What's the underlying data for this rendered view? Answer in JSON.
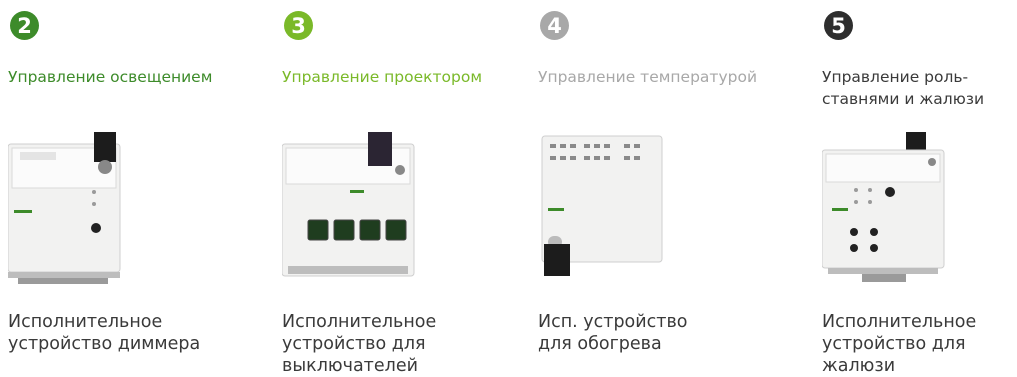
{
  "columns": [
    {
      "number": "2",
      "badge_color": "#3d8b2a",
      "title_color": "#3d8b2a",
      "title": "Управление освещением",
      "device_icon": "dimmer-actuator-icon",
      "caption": "Исполнительное\nустройство диммера"
    },
    {
      "number": "3",
      "badge_color": "#7ab929",
      "title_color": "#7ab929",
      "title": "Управление проектором",
      "device_icon": "switch-actuator-icon",
      "caption": "Исполнительное\nустройство для\nвыключателей"
    },
    {
      "number": "4",
      "badge_color": "#a8a8a8",
      "title_color": "#a8a8a8",
      "title": "Управление температурой",
      "device_icon": "heating-actuator-icon",
      "caption": "Исп. устройство\nдля обогрева"
    },
    {
      "number": "5",
      "badge_color": "#2e2e2e",
      "title_color": "#3a3a3a",
      "title": "Управление роль-\nставнями и жалюзи",
      "device_icon": "blind-actuator-icon",
      "caption": "Исполнительное\nустройство для\nжалюзи"
    }
  ]
}
